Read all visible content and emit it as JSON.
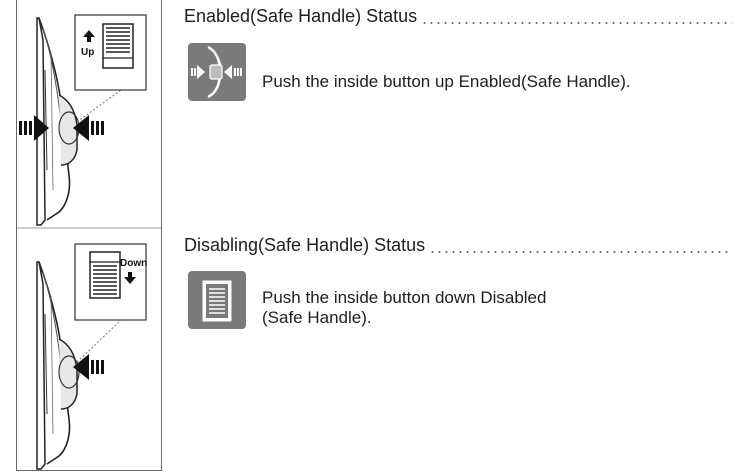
{
  "sections": [
    {
      "id": "enabled",
      "heading": "Enabled(Safe Handle) Status",
      "instruction_lines": [
        "Push the inside button up Enabled(Safe Handle)."
      ],
      "thumb_icon": "hand-pushing-button-icon",
      "callout_label": "Up",
      "callout_arrow": "up-arrow-icon"
    },
    {
      "id": "disabled",
      "heading": "Disabling(Safe Handle) Status",
      "instruction_lines": [
        "Push the inside button down Disabled",
        "(Safe Handle)."
      ],
      "thumb_icon": "lever-switch-icon",
      "callout_label": "Down",
      "callout_arrow": "down-arrow-icon"
    }
  ],
  "colors": {
    "thumb_bg": "#7a7a7a",
    "arrow": "#111111",
    "line_art": "#222222"
  }
}
